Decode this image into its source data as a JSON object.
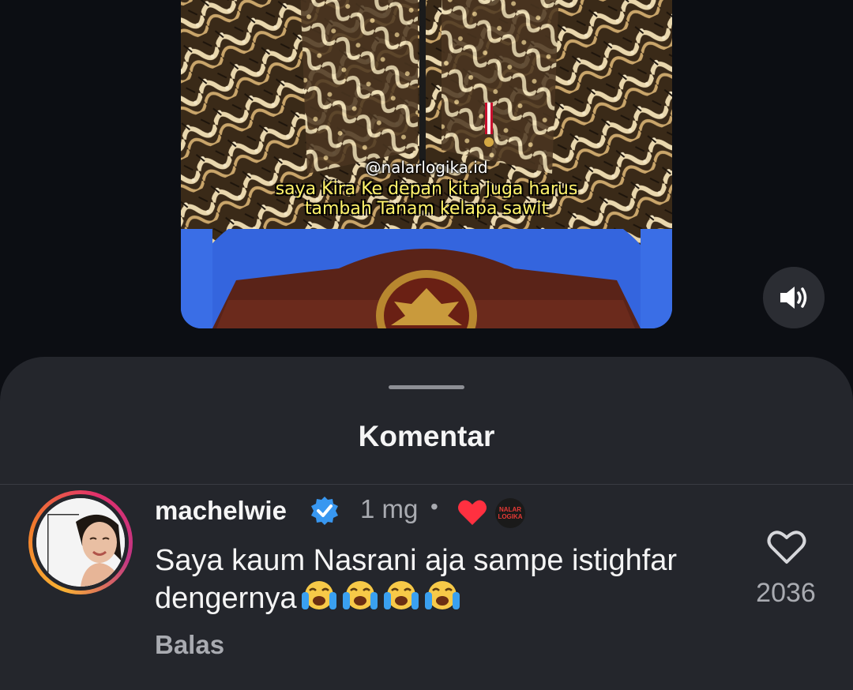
{
  "video": {
    "watermark": "@nalarlogika.id",
    "caption_line1": "saya Kira Ke depan kita juga harus",
    "caption_line2": "tambah Tanam kelapa sawit",
    "sound_icon": "speaker-on-icon"
  },
  "comments_sheet": {
    "title": "Komentar",
    "comment": {
      "username": "machelwie",
      "verified": true,
      "time": "1 mg",
      "separator": "•",
      "liked_by_creator": true,
      "creator_avatar_text": "NALAR LOGIKA",
      "text": "Saya kaum Nasrani aja sampe istighfar dengernya",
      "emojis": [
        "loudly-crying-face",
        "loudly-crying-face",
        "loudly-crying-face",
        "loudly-crying-face"
      ],
      "reply_label": "Balas",
      "like_count": "2036"
    }
  },
  "colors": {
    "sheet_bg": "#24262c",
    "page_bg": "#0c0e13",
    "caption_yellow": "#fff36a",
    "verified_blue": "#3897f0",
    "heart_red": "#ff3040"
  }
}
